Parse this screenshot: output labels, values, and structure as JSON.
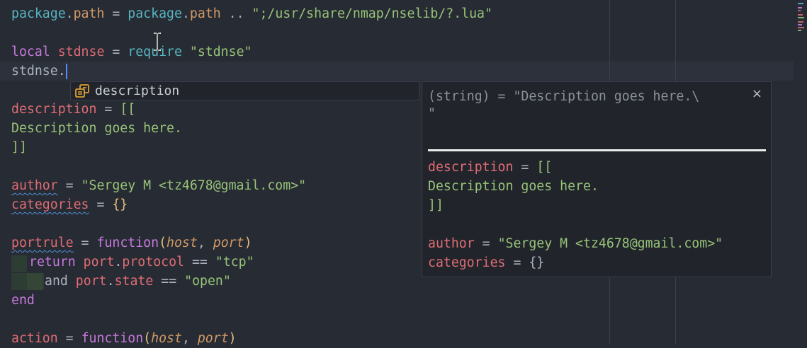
{
  "code": {
    "line0": {
      "a": "package",
      "b": ".",
      "c": "path",
      "d": " = ",
      "e": "package",
      "f": ".",
      "g": "path",
      "h": " .. ",
      "i": "\";/usr/share/nmap/nselib/?.lua\""
    },
    "line1": {
      "a": "local",
      "b": " stdnse ",
      "c": "= ",
      "d": "require",
      "e": " ",
      "f": "\"stdnse\""
    },
    "line2": {
      "a": "stdnse",
      "b": "."
    },
    "line3": {
      "a": "description",
      "b": " = ",
      "c": "[["
    },
    "line4": {
      "a": "Description goes here."
    },
    "line5": {
      "a": "]]"
    },
    "line6": {
      "a": "author",
      "b": " = ",
      "c": "\"Sergey M <tz4678@gmail.com>\""
    },
    "line7": {
      "a": "categories",
      "b": " = ",
      "c": "{}"
    },
    "line8": {
      "a": "portrule",
      "b": " = ",
      "c": "function",
      "d": "(",
      "e": "host",
      "f": ", ",
      "g": "port",
      "h": ")"
    },
    "line9": {
      "a": "return",
      "b": " port",
      "c": ".",
      "d": "protocol",
      "e": " == ",
      "f": "\"tcp\""
    },
    "line10": {
      "a": "and",
      "b": " port",
      "c": ".",
      "d": "state",
      "e": " == ",
      "f": "\"open\""
    },
    "line11": {
      "a": "end"
    },
    "line12": {
      "a": "action",
      "b": " = ",
      "c": "function",
      "d": "(",
      "e": "host",
      "f": ", ",
      "g": "port",
      "h": ")"
    }
  },
  "autocomplete": {
    "item_label": "description",
    "item_icon": "field-icon"
  },
  "doc_popup": {
    "signature1": "(string) = \"Description goes here.\\",
    "signature2": "\"",
    "close": "×",
    "body": {
      "l1a": "description",
      "l1b": " = ",
      "l1c": "[[",
      "l2": "Description goes here.",
      "l3": "]]",
      "l4a": "author",
      "l4b": " = ",
      "l4c": "\"Sergey M <tz4678@gmail.com>\"",
      "l5a": "categories",
      "l5b": " = ",
      "l5c": "{}"
    }
  },
  "colors": {
    "background": "#272b33",
    "keyword": "#c678dd",
    "string": "#98c379",
    "variable": "#e06c75",
    "property": "#d19a66",
    "function": "#56b6c2"
  }
}
